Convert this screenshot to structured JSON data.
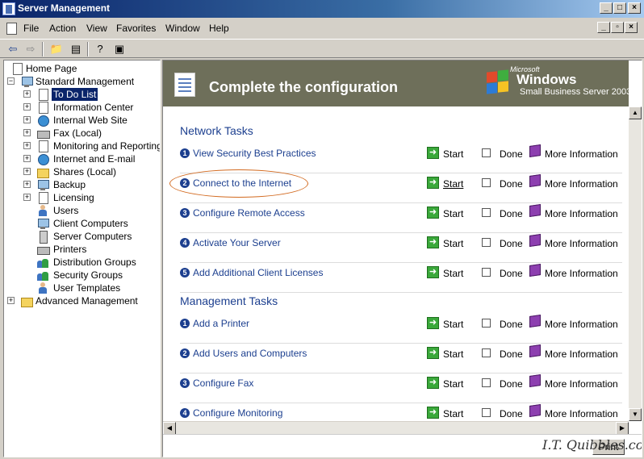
{
  "window": {
    "title": "Server Management",
    "minimize_icon": "minimize-icon",
    "restore_icon": "restore-icon",
    "close_icon": "close-icon"
  },
  "menu": [
    {
      "label": "File"
    },
    {
      "label": "Action"
    },
    {
      "label": "View"
    },
    {
      "label": "Favorites"
    },
    {
      "label": "Window"
    },
    {
      "label": "Help"
    }
  ],
  "tree": {
    "items": [
      {
        "label": "Home Page",
        "icon": "document-icon"
      },
      {
        "label": "Standard Management",
        "icon": "computer-icon"
      },
      {
        "label": "To Do List",
        "icon": "checklist-icon",
        "selected": true
      },
      {
        "label": "Information Center",
        "icon": "info-icon"
      },
      {
        "label": "Internal Web Site",
        "icon": "web-icon"
      },
      {
        "label": "Fax (Local)",
        "icon": "fax-icon"
      },
      {
        "label": "Monitoring and Reporting",
        "icon": "monitor-icon"
      },
      {
        "label": "Internet and E-mail",
        "icon": "globe-icon"
      },
      {
        "label": "Shares (Local)",
        "icon": "folder-icon"
      },
      {
        "label": "Backup",
        "icon": "backup-icon"
      },
      {
        "label": "Licensing",
        "icon": "license-icon"
      },
      {
        "label": "Users",
        "icon": "user-icon"
      },
      {
        "label": "Client Computers",
        "icon": "computer-icon"
      },
      {
        "label": "Server Computers",
        "icon": "server-icon"
      },
      {
        "label": "Printers",
        "icon": "printer-icon"
      },
      {
        "label": "Distribution Groups",
        "icon": "group-icon"
      },
      {
        "label": "Security Groups",
        "icon": "group-icon"
      },
      {
        "label": "User Templates",
        "icon": "user-icon"
      },
      {
        "label": "Advanced Management",
        "icon": "folder-icon"
      }
    ]
  },
  "banner": {
    "title": "Complete the configuration",
    "brand_microsoft": "Microsoft",
    "brand_windows": "Windows",
    "brand_product": "Small Business Server 2003"
  },
  "sections": [
    {
      "title": "Network Tasks"
    },
    {
      "title": "Management Tasks"
    }
  ],
  "network_tasks": [
    {
      "num": "1",
      "label": "View Security Best Practices"
    },
    {
      "num": "2",
      "label": "Connect to the Internet"
    },
    {
      "num": "3",
      "label": "Configure Remote Access"
    },
    {
      "num": "4",
      "label": "Activate Your Server"
    },
    {
      "num": "5",
      "label": "Add Additional Client Licenses"
    }
  ],
  "management_tasks": [
    {
      "num": "1",
      "label": "Add a Printer"
    },
    {
      "num": "2",
      "label": "Add Users and Computers"
    },
    {
      "num": "3",
      "label": "Configure Fax"
    },
    {
      "num": "4",
      "label": "Configure Monitoring"
    }
  ],
  "row_labels": {
    "start": "Start",
    "done": "Done",
    "more": "More Information"
  },
  "footer": {
    "print": "Print",
    "watermark": "I.T. Quibbles.com"
  },
  "colors": {
    "accent": "#1c3f8f",
    "banner": "#6e6f5a",
    "highlight": "#d2691e"
  }
}
